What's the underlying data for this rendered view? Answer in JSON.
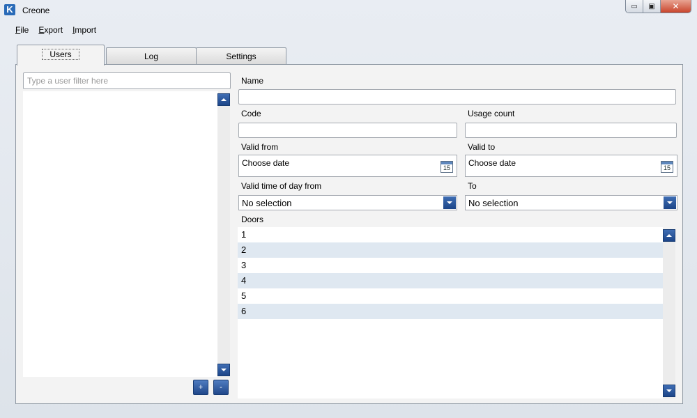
{
  "window": {
    "title": "Creone",
    "minimize_glyph": "▭",
    "maximize_glyph": "▣",
    "close_glyph": "✕"
  },
  "menu": {
    "items": [
      {
        "key": "F",
        "rest": "ile"
      },
      {
        "key": "E",
        "rest": "xport"
      },
      {
        "key": "I",
        "rest": "mport"
      }
    ]
  },
  "tabs": [
    {
      "label": "Users",
      "active": true
    },
    {
      "label": "Log",
      "active": false
    },
    {
      "label": "Settings",
      "active": false
    }
  ],
  "users": {
    "filter_placeholder": "Type a user filter here",
    "filter_value": "",
    "add_label": "+",
    "remove_label": "-"
  },
  "form": {
    "name_label": "Name",
    "code_label": "Code",
    "usage_count_label": "Usage count",
    "valid_from_label": "Valid from",
    "valid_from_value": "Choose date",
    "valid_to_label": "Valid to",
    "valid_to_value": "Choose date",
    "calendar_day": "15",
    "time_from_label": "Valid time of day from",
    "time_from_value": "No selection",
    "time_to_label": "To",
    "time_to_value": "No selection",
    "doors_label": "Doors"
  },
  "doors": [
    "1",
    "2",
    "3",
    "4",
    "5",
    "6"
  ]
}
